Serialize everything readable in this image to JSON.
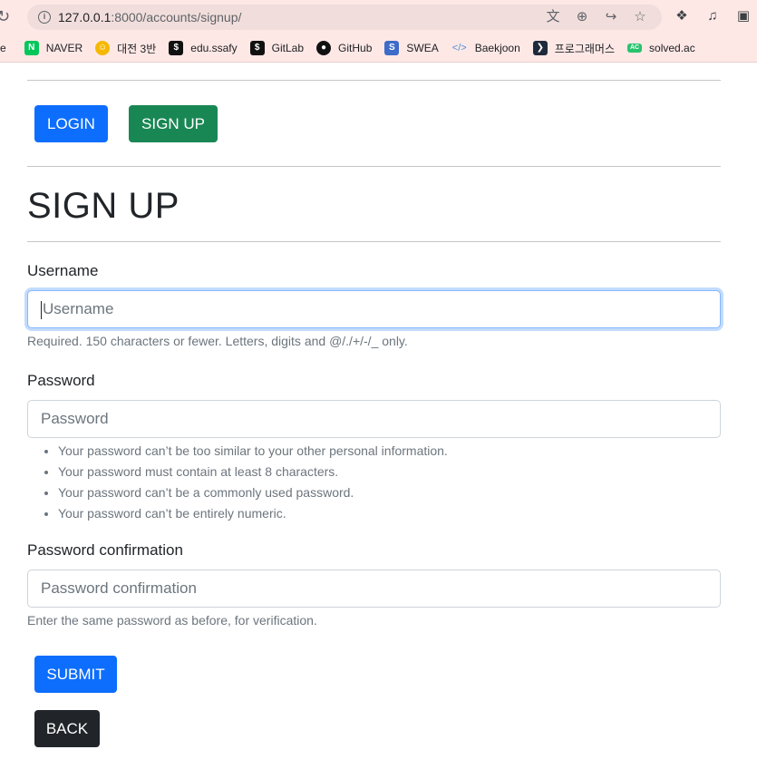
{
  "browser": {
    "url_host": "127.0.0.1",
    "url_rest": ":8000/accounts/signup/"
  },
  "bookmarks": [
    {
      "label": "e",
      "icon": ""
    },
    {
      "label": "NAVER",
      "icon": "N"
    },
    {
      "label": "대전 3반",
      "icon": ""
    },
    {
      "label": "edu.ssafy",
      "icon": ""
    },
    {
      "label": "GitLab",
      "icon": ""
    },
    {
      "label": "GitHub",
      "icon": ""
    },
    {
      "label": "SWEA",
      "icon": "S"
    },
    {
      "label": "Baekjoon",
      "icon": "</>"
    },
    {
      "label": "프로그래머스",
      "icon": ""
    },
    {
      "label": "solved.ac",
      "icon": "AC"
    }
  ],
  "nav": {
    "login_label": "LOGIN",
    "signup_label": "SIGN UP"
  },
  "page": {
    "title": "SIGN UP"
  },
  "form": {
    "username": {
      "label": "Username",
      "placeholder": "Username",
      "help": "Required. 150 characters or fewer. Letters, digits and @/./+/-/_ only."
    },
    "password": {
      "label": "Password",
      "placeholder": "Password",
      "rules": [
        "Your password can’t be too similar to your other personal information.",
        "Your password must contain at least 8 characters.",
        "Your password can’t be a commonly used password.",
        "Your password can’t be entirely numeric."
      ]
    },
    "password_confirmation": {
      "label": "Password confirmation",
      "placeholder": "Password confirmation",
      "help": "Enter the same password as before, for verification."
    },
    "submit_label": "SUBMIT",
    "back_label": "BACK"
  },
  "colors": {
    "primary": "#0d6efd",
    "success": "#198754",
    "dark": "#212529",
    "chrome": "#fde8e6"
  }
}
